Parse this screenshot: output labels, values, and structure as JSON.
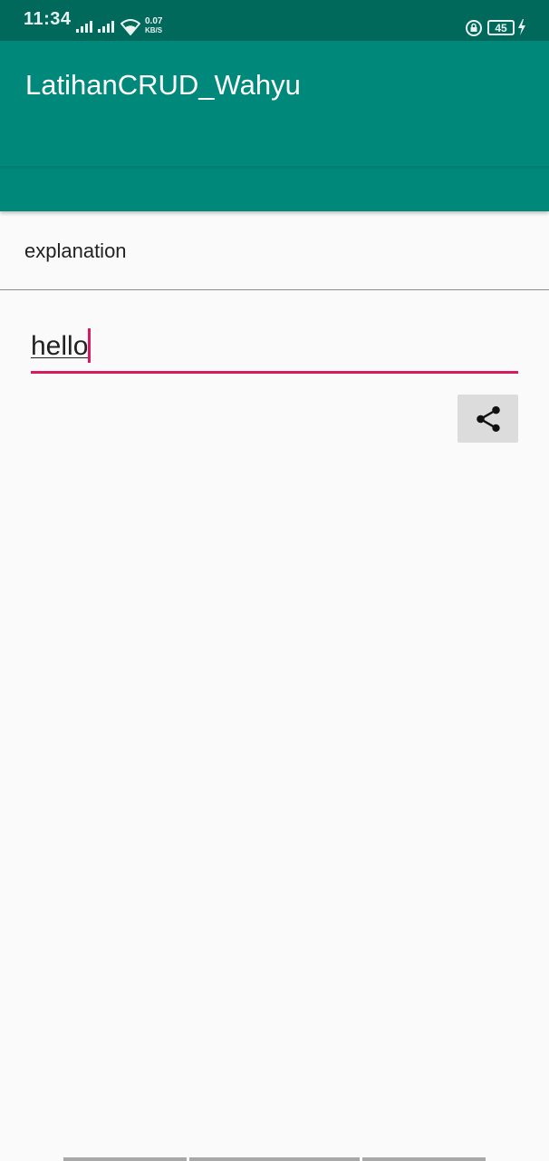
{
  "status_bar": {
    "time": "11:34",
    "net_speed_value": "0.07",
    "net_speed_unit": "KB/S",
    "battery_level": "45",
    "icons": [
      "signal-icon",
      "signal-icon",
      "wifi-icon",
      "rotation-lock-icon",
      "battery-icon",
      "charging-icon"
    ]
  },
  "app_bar": {
    "title": "LatihanCRUD_Wahyu",
    "color": "#00897b"
  },
  "content": {
    "section_label": "explanation",
    "input_value": "hello",
    "accent_color": "#d81b60",
    "share_button_icon": "share-icon"
  }
}
